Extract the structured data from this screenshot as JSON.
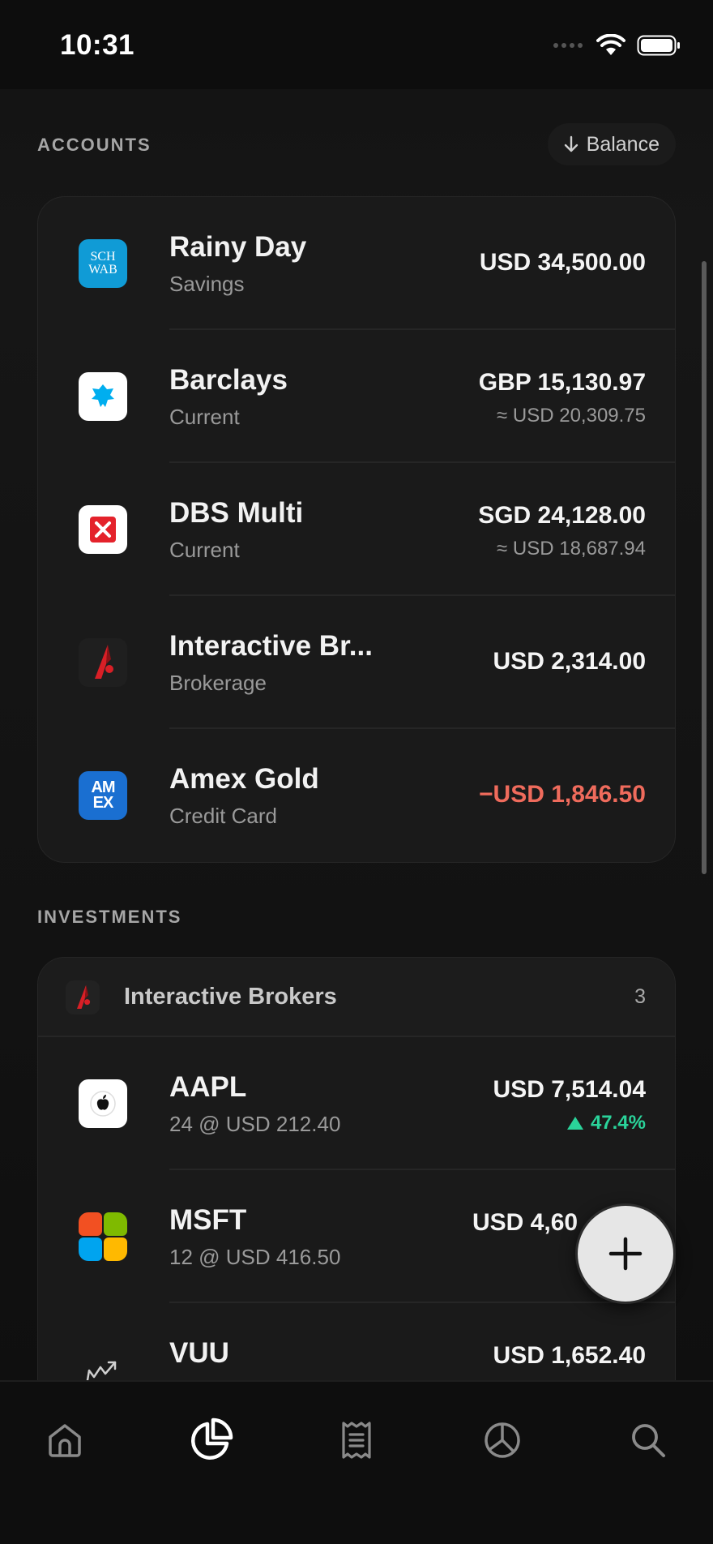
{
  "status": {
    "time": "10:31"
  },
  "accounts": {
    "heading": "ACCOUNTS",
    "sort_label": "Balance",
    "items": [
      {
        "name": "Rainy Day",
        "type": "Savings",
        "amount": "USD 34,500.00",
        "converted": "",
        "logo": "schwab-logo",
        "logo_text": [
          "SCH",
          "WAB"
        ]
      },
      {
        "name": "Barclays",
        "type": "Current",
        "amount": "GBP 15,130.97",
        "converted": "≈ USD 20,309.75",
        "logo": "barclays-logo"
      },
      {
        "name": "DBS Multi",
        "type": "Current",
        "amount": "SGD 24,128.00",
        "converted": "≈ USD 18,687.94",
        "logo": "dbs-logo"
      },
      {
        "name": "Interactive Br...",
        "type": "Brokerage",
        "amount": "USD 2,314.00",
        "converted": "",
        "logo": "interactive-brokers-logo"
      },
      {
        "name": "Amex Gold",
        "type": "Credit Card",
        "amount": "−USD 1,846.50",
        "converted": "",
        "logo": "amex-logo",
        "logo_text": [
          "AM",
          "EX"
        ],
        "negative": true
      }
    ]
  },
  "investments": {
    "heading": "INVESTMENTS",
    "group_name": "Interactive Brokers",
    "group_count": "3",
    "items": [
      {
        "ticker": "AAPL",
        "detail": "24 @ USD 212.40",
        "amount": "USD 7,514.04",
        "change": "47.4%",
        "logo": "apple-logo"
      },
      {
        "ticker": "MSFT",
        "detail": "12 @ USD 416.50",
        "amount": "USD 4,60",
        "logo": "microsoft-logo"
      },
      {
        "ticker": "VUU",
        "detail": "",
        "amount": "USD 1,652.40",
        "logo": "trend-chart-icon"
      }
    ]
  },
  "colors": {
    "negative": "#ef6b5c",
    "positive": "#2ad39a",
    "background": "#0d0d0d",
    "card": "#1a1a1a"
  },
  "tabs": [
    "home-icon",
    "portfolio-pie-icon",
    "receipt-icon",
    "analytics-pie-icon",
    "search-icon"
  ]
}
